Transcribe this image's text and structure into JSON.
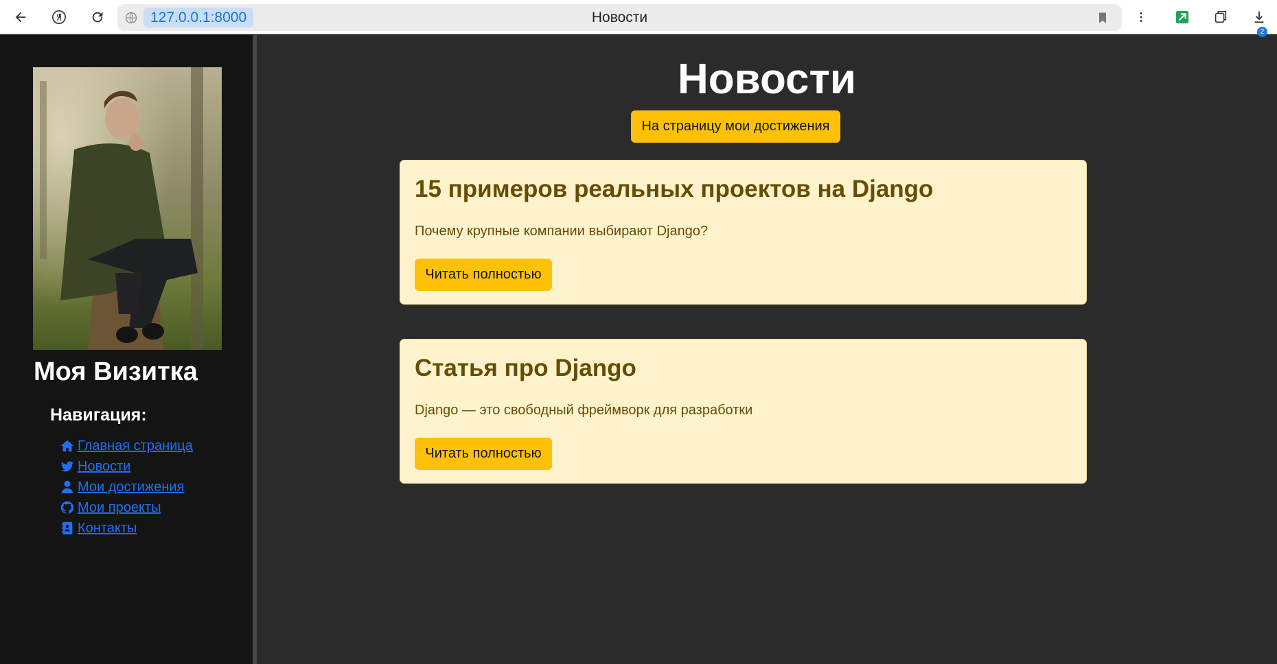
{
  "browser": {
    "url": "127.0.0.1:8000",
    "tab_title": "Новости",
    "downloads_count": "2"
  },
  "sidebar": {
    "brand": "Моя Визитка",
    "nav_title": "Навигация:",
    "links": [
      {
        "label": "Главная страница",
        "icon": "home-icon"
      },
      {
        "label": "Новости",
        "icon": "twitter-icon"
      },
      {
        "label": "Мои достижения",
        "icon": "user-icon"
      },
      {
        "label": "Мои проекты",
        "icon": "github-icon"
      },
      {
        "label": "Контакты",
        "icon": "contact-book-icon"
      }
    ]
  },
  "main": {
    "title": "Новости",
    "achievements_button": "На страницу мои достижения",
    "articles": [
      {
        "title": "15 примеров реальных проектов на Django",
        "summary": "Почему крупные компании выбирают Django?",
        "button": "Читать полностью"
      },
      {
        "title": "Статья про Django",
        "summary": "Django — это свободный фреймворк для разработки",
        "button": "Читать полностью"
      }
    ]
  },
  "colors": {
    "accent": "#ffc107",
    "card_bg": "#fff3cd",
    "card_text": "#664d03",
    "link": "#1e6ff5",
    "sidebar_bg": "#141414",
    "main_bg": "#2b2b2b"
  }
}
